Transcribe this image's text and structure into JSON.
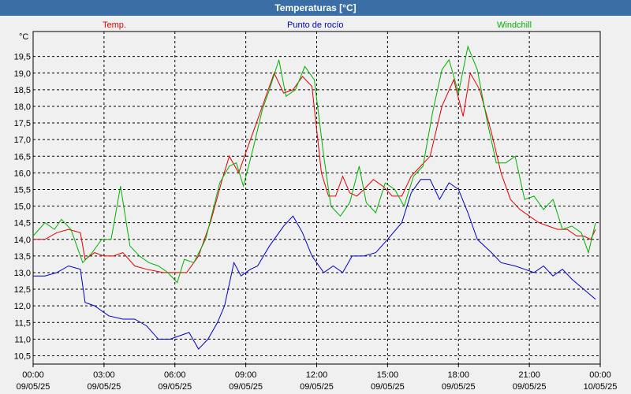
{
  "window": {
    "title": "Temperaturas [°C]"
  },
  "chart_data": {
    "type": "line",
    "title": "Temperaturas [°C]",
    "ylabel": "°C",
    "ylim": [
      10.25,
      20.25
    ],
    "yticks": [
      10.5,
      11.0,
      11.5,
      12.0,
      12.5,
      13.0,
      13.5,
      14.0,
      14.5,
      15.0,
      15.5,
      16.0,
      16.5,
      17.0,
      17.5,
      18.0,
      18.5,
      19.0,
      19.5
    ],
    "ytick_labels": [
      "10,5",
      "11,0",
      "11,5",
      "12,0",
      "12,5",
      "13,0",
      "13,5",
      "14,0",
      "14,5",
      "15,0",
      "15,5",
      "16,0",
      "16,5",
      "17,0",
      "17,5",
      "18,0",
      "18,5",
      "19,0",
      "19,5"
    ],
    "xlim_hours": [
      0,
      24
    ],
    "x_hours": [
      0,
      0.5,
      1,
      1.5,
      2,
      2.5,
      3,
      3.5,
      4,
      4.5,
      5,
      5.5,
      6,
      6.5,
      7,
      7.5,
      8,
      8.5,
      9,
      9.5,
      10,
      10.5,
      11,
      11.5,
      12,
      12.5,
      13,
      13.5,
      14,
      14.5,
      15,
      15.5,
      16,
      16.5,
      17,
      17.5,
      18,
      18.5,
      19,
      19.5,
      20,
      20.5,
      21,
      21.5,
      22,
      22.5,
      23,
      23.5,
      24
    ],
    "xticks": [
      {
        "h": 0,
        "time": "00:00",
        "date": "09/05/25"
      },
      {
        "h": 3,
        "time": "03:00",
        "date": "09/05/25"
      },
      {
        "h": 6,
        "time": "06:00",
        "date": "09/05/25"
      },
      {
        "h": 9,
        "time": "09:00",
        "date": "09/05/25"
      },
      {
        "h": 12,
        "time": "12:00",
        "date": "09/05/25"
      },
      {
        "h": 15,
        "time": "15:00",
        "date": "09/05/25"
      },
      {
        "h": 18,
        "time": "18:00",
        "date": "09/05/25"
      },
      {
        "h": 21,
        "time": "21:00",
        "date": "09/05/25"
      },
      {
        "h": 24,
        "time": "00:00",
        "date": "10/05/25"
      }
    ],
    "grid": true,
    "series": [
      {
        "name": "Temp.",
        "color": "#e00000",
        "values": [
          14.0,
          14.0,
          14.2,
          14.3,
          14.2,
          13.4,
          13.6,
          13.5,
          13.5,
          13.6,
          13.2,
          13.1,
          13.0,
          13.0,
          13.0,
          13.5,
          14.5,
          15.8,
          16.5,
          16.0,
          17.0,
          17.8,
          19.0,
          18.4,
          18.5,
          18.9,
          18.6,
          16.0,
          15.3,
          15.3,
          15.9,
          15.4,
          15.3,
          15.5,
          15.8,
          15.6,
          15.3,
          15.3,
          15.9,
          16.2,
          16.5,
          18.0,
          18.8,
          17.7,
          19.0,
          18.5,
          17.2,
          16.0,
          15.2,
          14.9,
          14.7,
          14.5,
          14.4,
          14.3,
          14.3,
          14.1,
          14.1,
          14.0,
          14.3
        ],
        "hours": [
          0,
          0.5,
          1,
          1.5,
          2,
          2.2,
          2.6,
          3.0,
          3.4,
          3.8,
          4.3,
          4.8,
          5.5,
          6.0,
          6.5,
          7.0,
          7.5,
          8.0,
          8.3,
          8.7,
          9.2,
          9.6,
          10.2,
          10.6,
          11.0,
          11.4,
          11.8,
          12.2,
          12.5,
          12.8,
          13.1,
          13.4,
          13.7,
          14.0,
          14.4,
          14.8,
          15.2,
          15.6,
          16.0,
          16.4,
          16.8,
          17.3,
          17.8,
          18.2,
          18.5,
          18.9,
          19.4,
          19.8,
          20.2,
          20.6,
          21.0,
          21.4,
          21.8,
          22.2,
          22.6,
          23.0,
          23.3,
          23.6,
          23.8
        ]
      },
      {
        "name": "Punto de rocío",
        "color": "#0000c0",
        "values": [
          12.9,
          12.9,
          13.0,
          13.2,
          13.1,
          12.1,
          12.0,
          11.7,
          11.6,
          11.6,
          11.4,
          11.0,
          11.0,
          11.1,
          11.2,
          10.7,
          11.0,
          11.5,
          12.0,
          13.3,
          12.9,
          13.1,
          13.2,
          13.8,
          14.4,
          14.7,
          14.2,
          13.5,
          13.0,
          13.2,
          13.0,
          13.5,
          13.5,
          13.6,
          14.0,
          14.5,
          15.4,
          15.8,
          15.8,
          15.2,
          15.7,
          15.5,
          14.8,
          14.0,
          13.6,
          13.3,
          13.2,
          13.1,
          13.0,
          13.2,
          12.9,
          13.1,
          12.8,
          12.2
        ],
        "hours": [
          0,
          0.5,
          1,
          1.5,
          2,
          2.2,
          2.6,
          3.2,
          3.8,
          4.3,
          4.8,
          5.3,
          5.8,
          6.2,
          6.6,
          7.0,
          7.4,
          7.8,
          8.1,
          8.5,
          8.8,
          9.2,
          9.5,
          10.0,
          10.6,
          11.0,
          11.4,
          11.8,
          12.3,
          12.7,
          13.1,
          13.5,
          14.0,
          14.5,
          15.0,
          15.6,
          16.0,
          16.4,
          16.8,
          17.2,
          17.6,
          18.0,
          18.4,
          18.8,
          19.4,
          19.8,
          20.4,
          20.8,
          21.2,
          21.6,
          22.0,
          22.4,
          22.8,
          23.8
        ]
      },
      {
        "name": "Windchill",
        "color": "#00b000",
        "values": [
          14.1,
          14.5,
          14.3,
          14.6,
          14.3,
          13.3,
          13.6,
          14.0,
          14.0,
          15.6,
          13.8,
          13.5,
          13.3,
          13.2,
          13.0,
          12.7,
          13.4,
          13.3,
          14.0,
          15.7,
          16.2,
          16.3,
          15.6,
          16.7,
          17.9,
          18.5,
          19.4,
          18.3,
          18.5,
          19.2,
          18.8,
          16.5,
          15.0,
          14.7,
          15.1,
          16.2,
          15.1,
          14.8,
          15.7,
          15.5,
          15.0,
          15.9,
          16.2,
          17.8,
          19.1,
          19.4,
          18.4,
          19.8,
          19.1,
          17.6,
          16.3,
          16.3,
          16.5,
          15.2,
          15.3,
          14.9,
          15.2,
          14.3,
          14.4,
          14.2,
          13.6,
          14.5
        ],
        "hours": [
          0,
          0.5,
          0.9,
          1.2,
          1.6,
          2.1,
          2.5,
          2.9,
          3.3,
          3.7,
          4.1,
          4.5,
          4.9,
          5.3,
          5.7,
          6.1,
          6.4,
          6.8,
          7.3,
          7.9,
          8.3,
          8.6,
          8.9,
          9.3,
          9.7,
          10.0,
          10.4,
          10.7,
          11.1,
          11.5,
          11.9,
          12.3,
          12.6,
          13.0,
          13.4,
          13.8,
          14.1,
          14.5,
          14.9,
          15.3,
          15.7,
          16.1,
          16.5,
          16.9,
          17.3,
          17.6,
          18.0,
          18.4,
          18.8,
          19.2,
          19.6,
          20.0,
          20.4,
          20.8,
          21.2,
          21.6,
          22.0,
          22.4,
          22.8,
          23.2,
          23.5,
          23.8
        ]
      }
    ]
  }
}
